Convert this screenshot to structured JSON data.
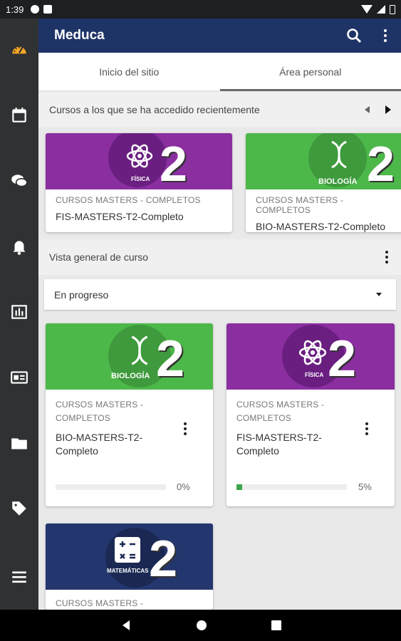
{
  "status_bar": {
    "time": "1:39"
  },
  "app_bar": {
    "title": "Meduca",
    "search_icon": "search-icon",
    "menu_icon": "more-vert-icon"
  },
  "sidebar": {
    "items": [
      "dashboard-icon",
      "calendar-icon",
      "chat-icon",
      "bell-icon",
      "grades-icon",
      "badge-icon",
      "folder-icon",
      "tag-icon",
      "menu-icon"
    ]
  },
  "tabs": [
    {
      "label": "Inicio del sitio"
    },
    {
      "label": "Área personal",
      "active": true
    }
  ],
  "recent": {
    "heading": "Cursos a los que se ha accedido recientemente",
    "cards": [
      {
        "category": "CURSOS MASTERS - COMPLETOS",
        "name": "FIS-MASTERS-T2-Completo",
        "image_label": "FÍSICA",
        "image_number": "2"
      },
      {
        "category": "CURSOS MASTERS - COMPLETOS",
        "name": "BIO-MASTERS-T2-Completo",
        "image_label": "BIOLOGÍA",
        "image_number": "2"
      }
    ]
  },
  "overview": {
    "heading": "Vista general de curso",
    "filter": "En progreso",
    "courses": [
      {
        "category": "CURSOS MASTERS - COMPLETOS",
        "name": "BIO-MASTERS-T2-Completo",
        "image_label": "BIOLOGÍA",
        "image_number": "2",
        "progress": 0,
        "progress_label": "0%"
      },
      {
        "category": "CURSOS MASTERS - COMPLETOS",
        "name": "FIS-MASTERS-T2-Completo",
        "image_label": "FÍSICA",
        "image_number": "2",
        "progress": 5,
        "progress_label": "5%"
      },
      {
        "category": "CURSOS MASTERS -",
        "image_label": "MATEMÁTICAS",
        "image_number": "2"
      }
    ]
  },
  "colors": {
    "app_bar": "#1e3366",
    "sidebar": "#2f3133",
    "biology": "#4db84a",
    "physics": "#8a2ea0",
    "math": "#24366e",
    "accent_dashboard": "#f5a623",
    "progress": "#3aa64a"
  }
}
